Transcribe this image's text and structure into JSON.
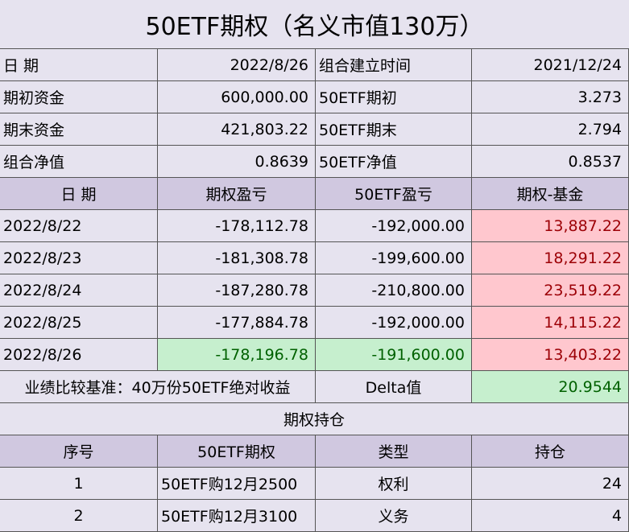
{
  "title": "50ETF期权（名义市值130万）",
  "info": [
    {
      "label": "日  期",
      "value": "2022/8/26",
      "label2": "组合建立时间",
      "value2": "2021/12/24"
    },
    {
      "label": "期初资金",
      "value": "600,000.00",
      "label2": "50ETF期初",
      "value2": "3.273"
    },
    {
      "label": "期末资金",
      "value": "421,803.22",
      "label2": "50ETF期末",
      "value2": "2.794"
    },
    {
      "label": "组合净值",
      "value": "0.8639",
      "label2": "50ETF净值",
      "value2": "0.8537"
    }
  ],
  "pnl_headers": [
    "日  期",
    "期权盈亏",
    "50ETF盈亏",
    "期权-基金"
  ],
  "pnl_rows": [
    {
      "date": "2022/8/22",
      "option": "-178,112.78",
      "etf": "-192,000.00",
      "diff": "13,887.22"
    },
    {
      "date": "2022/8/23",
      "option": "-181,308.78",
      "etf": "-199,600.00",
      "diff": "18,291.22"
    },
    {
      "date": "2022/8/24",
      "option": "-187,280.78",
      "etf": "-210,800.00",
      "diff": "23,519.22"
    },
    {
      "date": "2022/8/25",
      "option": "-177,884.78",
      "etf": "-192,000.00",
      "diff": "14,115.22"
    },
    {
      "date": "2022/8/26",
      "option": "-178,196.78",
      "etf": "-191,600.00",
      "diff": "13,403.22"
    }
  ],
  "benchmark": {
    "label": "业绩比较基准：40万份50ETF绝对收益",
    "delta_label": "Delta值",
    "delta_value": "20.9544"
  },
  "positions_title": "期权持仓",
  "positions_headers": [
    "序号",
    "50ETF期权",
    "类型",
    "持仓"
  ],
  "positions": [
    {
      "no": "1",
      "name": "50ETF购12月2500",
      "type": "权利",
      "qty": "24"
    },
    {
      "no": "2",
      "name": "50ETF购12月3100",
      "type": "义务",
      "qty": "4"
    }
  ],
  "colors": {
    "header_bg": "#d0c8e0",
    "sheet_bg": "#e6e3ef",
    "loss_bg": "#ffc7ce",
    "loss_text": "#9c0006",
    "gain_bg": "#c6efce",
    "gain_text": "#006100"
  }
}
